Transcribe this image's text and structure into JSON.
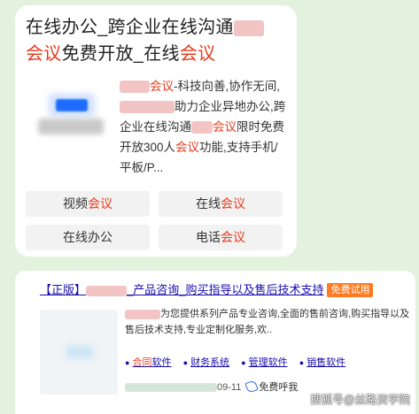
{
  "card1": {
    "title_part1": "在线办公_跨企业在线沟通",
    "title_part2_hl": "会议",
    "title_part3": "免费开放_在线",
    "title_part4_hl": "会议",
    "desc": {
      "hl1": "会议",
      "t1": "-科技向善,协作无间,",
      "t2": "助力企业异地办公,跨企业在线沟通",
      "hl2": "会议",
      "t3": "限时免费开放300人",
      "hl3": "会议",
      "t4": "功能,支持手机/平板/P..."
    },
    "buttons": [
      {
        "text": "视频",
        "hl": "会议"
      },
      {
        "text": "在线",
        "hl": "会议"
      },
      {
        "text": "在线办公",
        "hl": ""
      },
      {
        "text": "电话",
        "hl": "会议"
      }
    ]
  },
  "card2": {
    "title": "【正版】",
    "title_rest": "_产品咨询_购买指导以及售后技术支持",
    "badge": "免费试用",
    "desc": "为您提供系列产品专业咨询,全面的售前咨询,购买指导以及售后技术支持,专业定制化服务,欢..",
    "links": [
      {
        "hl": "合同",
        "text": "软件"
      },
      {
        "hl": "",
        "text": "财务系统"
      },
      {
        "hl": "",
        "text": "管理软件",
        "hl_suffix": "软件"
      },
      {
        "hl": "",
        "text": "销售软件",
        "hl_suffix": "软件"
      }
    ],
    "date": "09-11",
    "phone": "免费呼我"
  },
  "watermark": "搜狐号@丝路资学院",
  "colors": {
    "background": "#e3f2df",
    "highlight": "#e63c1e",
    "link": "#1a0dab",
    "badge": "#ff7a22"
  }
}
